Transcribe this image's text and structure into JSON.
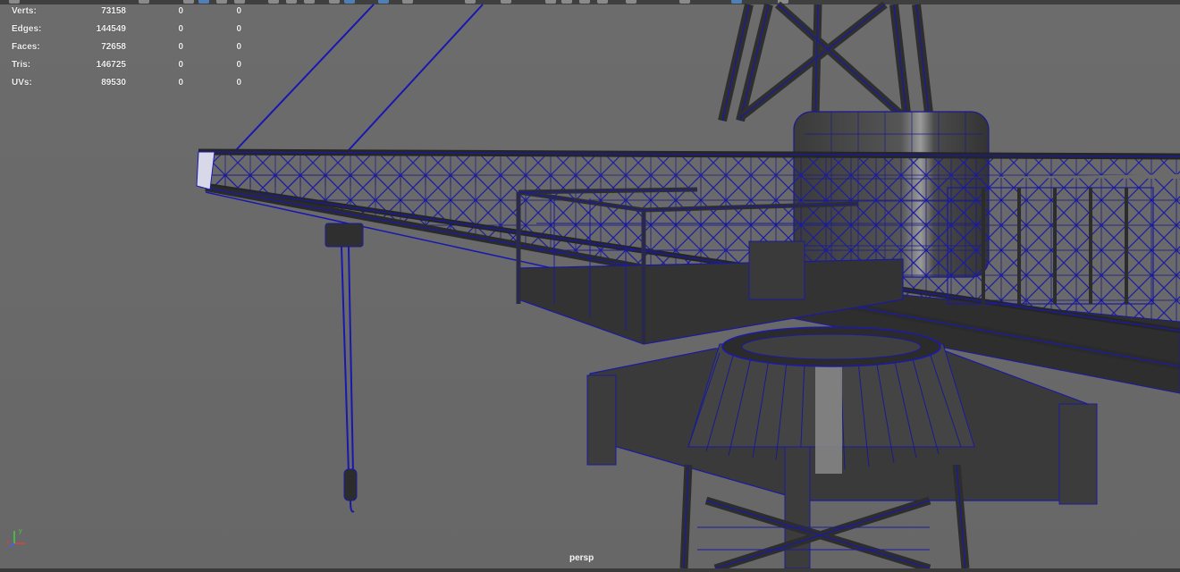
{
  "viewport": {
    "camera_label": "persp"
  },
  "heads_up_display": {
    "rows": [
      {
        "label": "Verts:",
        "total": "73158",
        "selected": "0",
        "selected_component": "0"
      },
      {
        "label": "Edges:",
        "total": "144549",
        "selected": "0",
        "selected_component": "0"
      },
      {
        "label": "Faces:",
        "total": "72658",
        "selected": "0",
        "selected_component": "0"
      },
      {
        "label": "Tris:",
        "total": "146725",
        "selected": "0",
        "selected_component": "0"
      },
      {
        "label": "UVs:",
        "total": "89530",
        "selected": "0",
        "selected_component": "0"
      }
    ]
  },
  "axis_gizmo": {
    "labels": [
      "y",
      "x"
    ],
    "colors": {
      "x": "#e04040",
      "y": "#40d040",
      "z": "#4060ff"
    }
  },
  "colors": {
    "viewport_background": "#6b6b6b",
    "wireframe": "#1a1aa8",
    "mesh_shade": "#333333",
    "hud_text": "#f2f2f2"
  }
}
